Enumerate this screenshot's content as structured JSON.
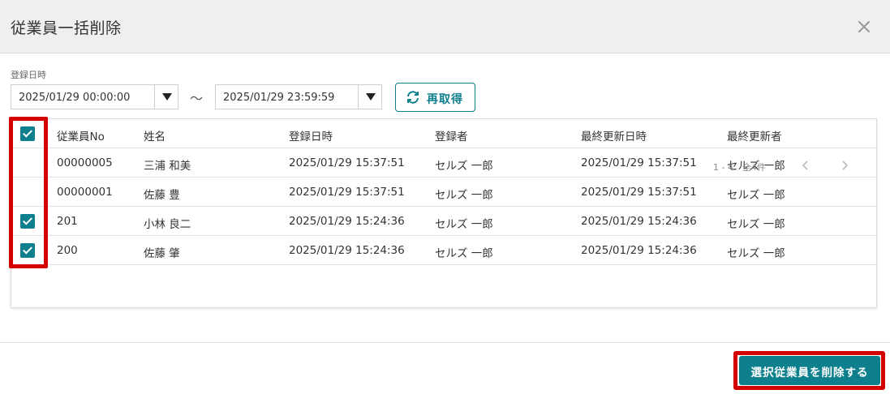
{
  "dialog": {
    "title": "従業員一括削除"
  },
  "filter": {
    "label": "登録日時",
    "from": "2025/01/29 00:00:00",
    "to": "2025/01/29 23:59:59",
    "separator": "～",
    "refetch_label": "再取得"
  },
  "table": {
    "headers": [
      "従業員No",
      "姓名",
      "登録日時",
      "登録者",
      "最終更新日時",
      "最終更新者"
    ],
    "header_checked": true,
    "rows": [
      {
        "checked": false,
        "no": "00000005",
        "name": "三浦 和美",
        "registered": "2025/01/29 15:37:51",
        "registered_by": "セルズ 一郎",
        "updated": "2025/01/29 15:37:51",
        "updated_by": "セルズ 一郎"
      },
      {
        "checked": false,
        "no": "00000001",
        "name": "佐藤 豊",
        "registered": "2025/01/29 15:37:51",
        "registered_by": "セルズ 一郎",
        "updated": "2025/01/29 15:37:51",
        "updated_by": "セルズ 一郎"
      },
      {
        "checked": true,
        "no": "201",
        "name": "小林 良二",
        "registered": "2025/01/29 15:24:36",
        "registered_by": "セルズ 一郎",
        "updated": "2025/01/29 15:24:36",
        "updated_by": "セルズ 一郎"
      },
      {
        "checked": true,
        "no": "200",
        "name": "佐藤 肇",
        "registered": "2025/01/29 15:24:36",
        "registered_by": "セルズ 一郎",
        "updated": "2025/01/29 15:24:36",
        "updated_by": "セルズ 一郎"
      }
    ]
  },
  "pager": {
    "summary": "1 - 4　全4件"
  },
  "footer": {
    "delete_label": "選択従業員を削除する"
  },
  "colors": {
    "accent": "#0e7f8d",
    "highlight": "#d40000"
  },
  "icons": {
    "close": "close-icon",
    "refresh": "refresh-icon",
    "prev": "chevron-left-icon",
    "next": "chevron-right-icon"
  }
}
